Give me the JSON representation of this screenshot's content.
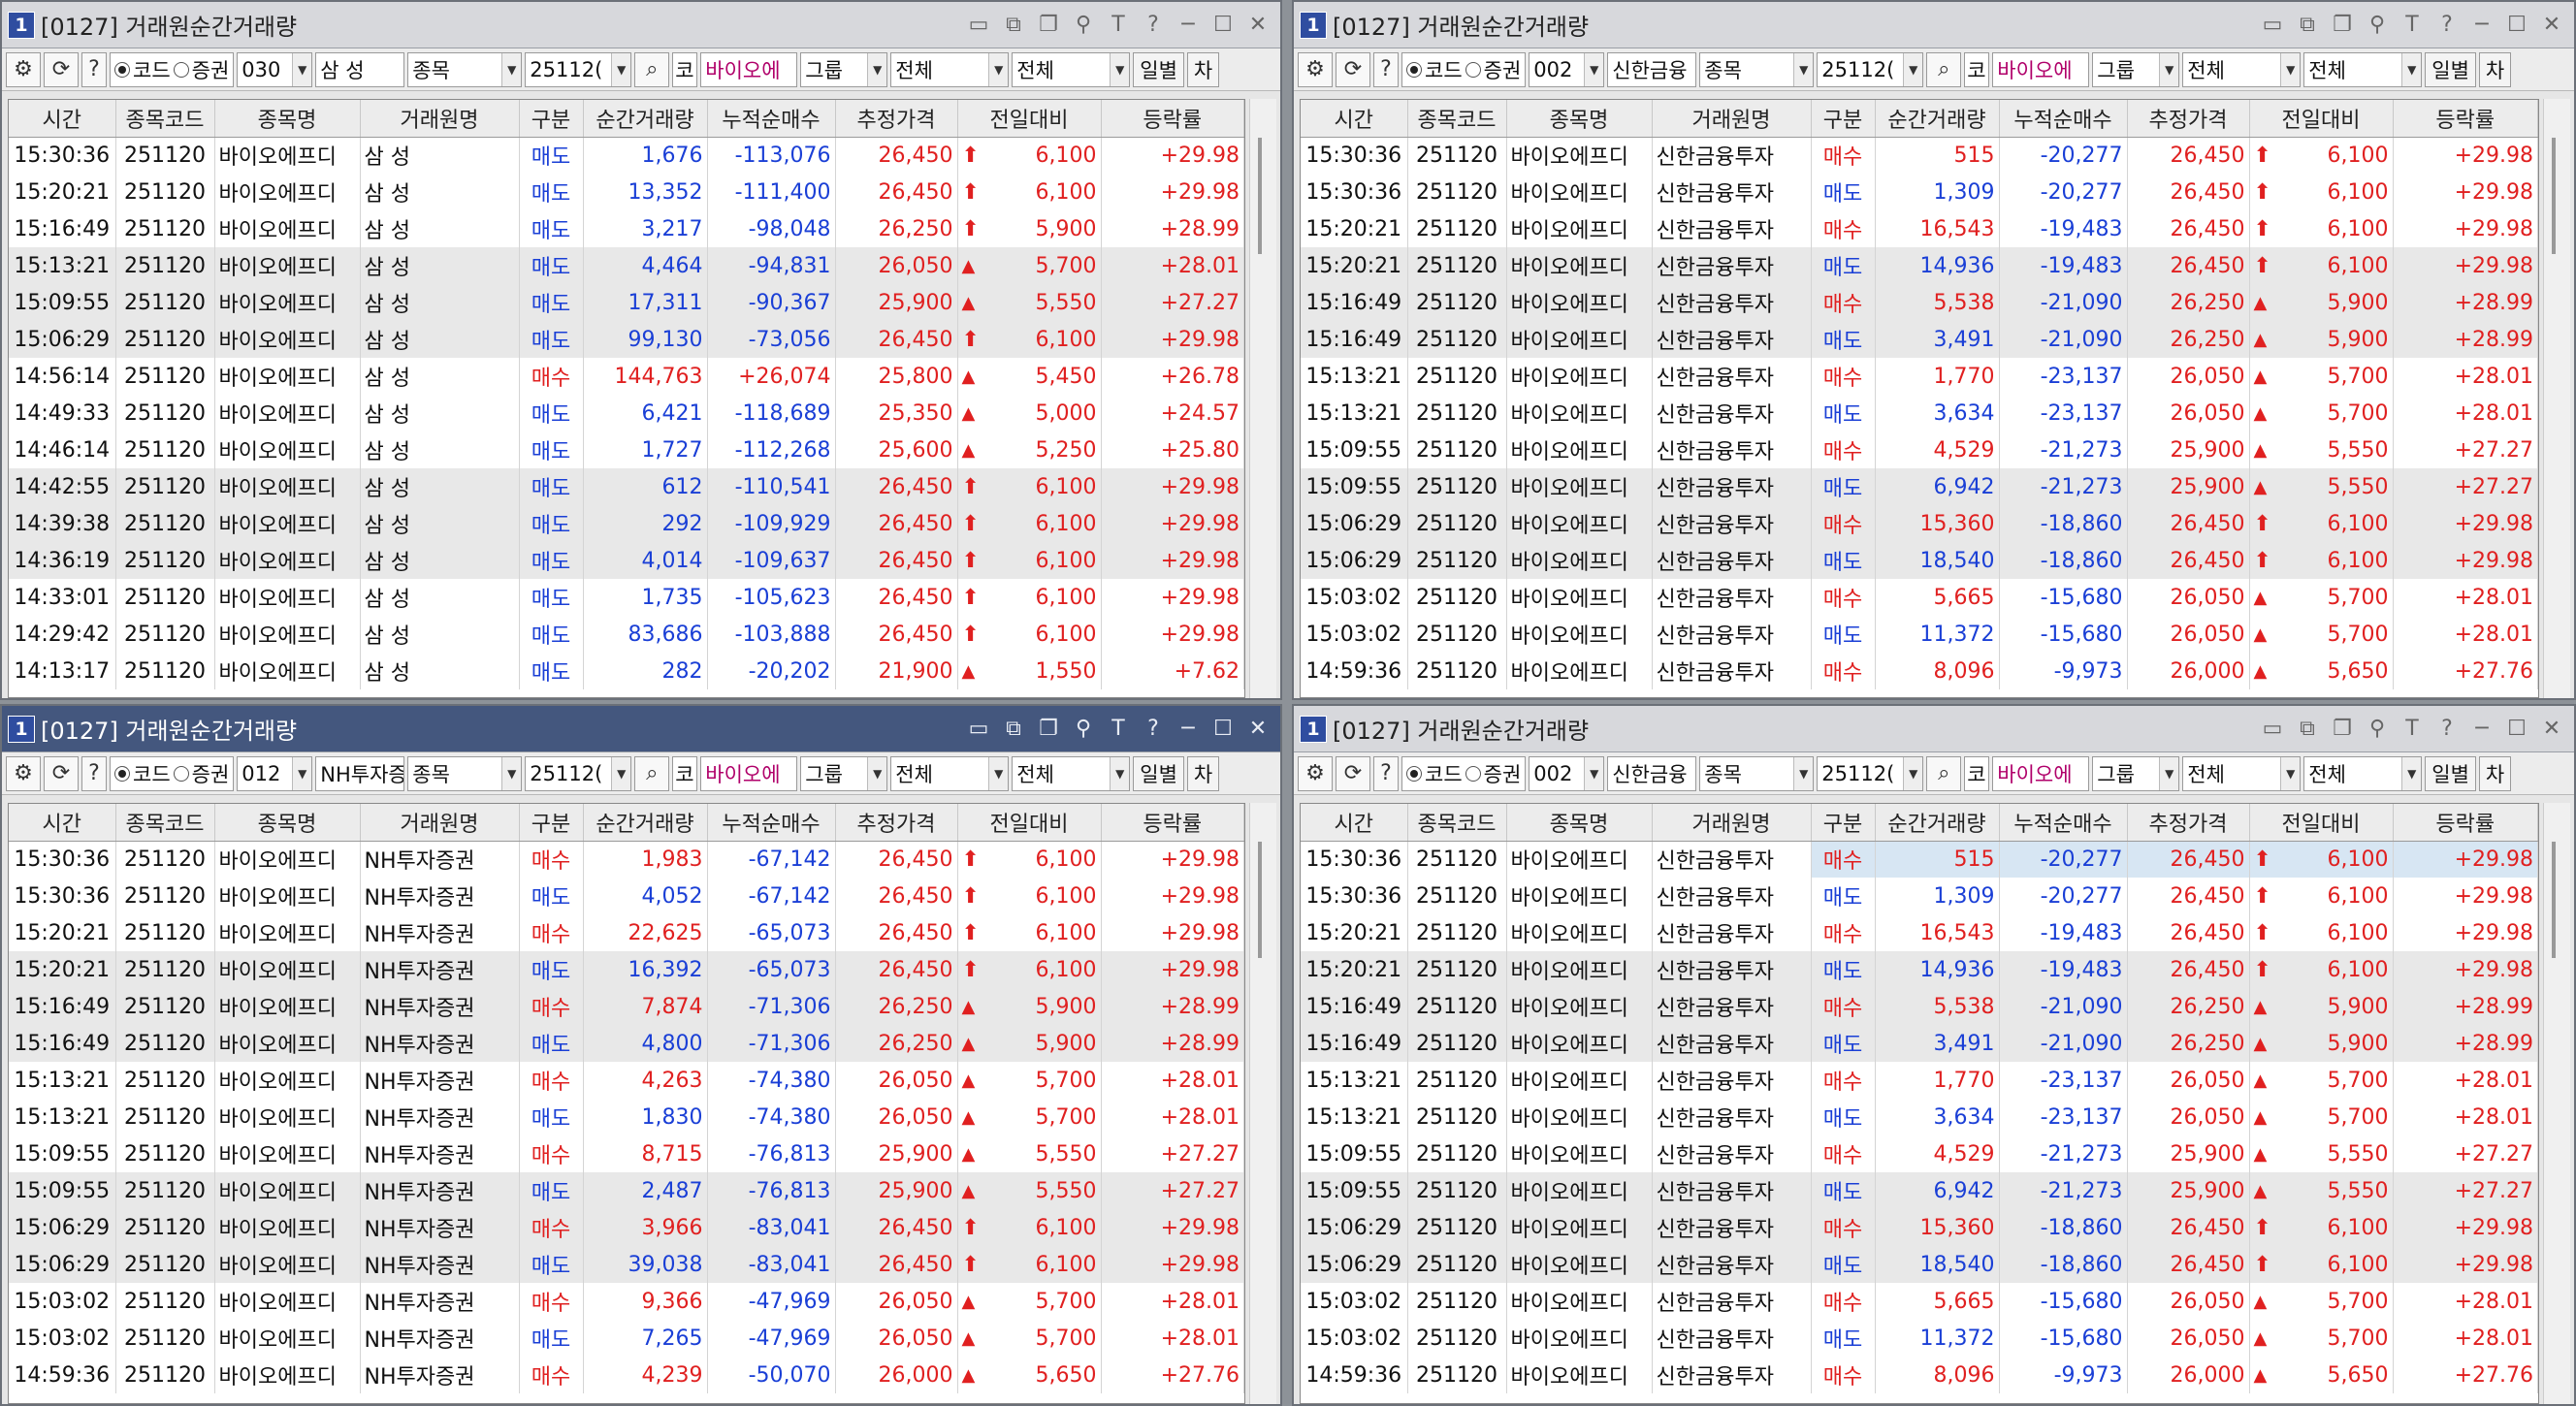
{
  "common": {
    "stock_code": "251120",
    "stock_name": "바이오에프디",
    "columns": [
      "시간",
      "종목코드",
      "종목명",
      "거래원명",
      "구분",
      "순간거래량",
      "누적순매수",
      "추정가격",
      "전일대비",
      "등락률"
    ]
  },
  "toolbar_labels": {
    "radio_code": "코드",
    "radio_broker": "증권",
    "type_combo": "종목",
    "code_field": "25112(",
    "ko_badge": "코",
    "stock_field": "바이오에",
    "group_button": "그룹",
    "filter1": "전체",
    "filter2": "전체",
    "daily_button": "일별",
    "chart_button": "차"
  },
  "windows": [
    {
      "title": "[0127] 거래원순간거래량",
      "num": "1",
      "active": false,
      "broker_code": "030",
      "broker_name": "삼   성",
      "rows": [
        [
          "15:30:36",
          "251120",
          "바이오에프디",
          "삼    성",
          "매도",
          "1,676",
          "-113,076",
          "26,450",
          "arrow",
          "6,100",
          "+29.98"
        ],
        [
          "15:20:21",
          "251120",
          "바이오에프디",
          "삼    성",
          "매도",
          "13,352",
          "-111,400",
          "26,450",
          "arrow",
          "6,100",
          "+29.98"
        ],
        [
          "15:16:49",
          "251120",
          "바이오에프디",
          "삼    성",
          "매도",
          "3,217",
          "-98,048",
          "26,250",
          "arrow",
          "5,900",
          "+28.99"
        ],
        [
          "15:13:21",
          "251120",
          "바이오에프디",
          "삼    성",
          "매도",
          "4,464",
          "-94,831",
          "26,050",
          "tri",
          "5,700",
          "+28.01"
        ],
        [
          "15:09:55",
          "251120",
          "바이오에프디",
          "삼    성",
          "매도",
          "17,311",
          "-90,367",
          "25,900",
          "tri",
          "5,550",
          "+27.27"
        ],
        [
          "15:06:29",
          "251120",
          "바이오에프디",
          "삼    성",
          "매도",
          "99,130",
          "-73,056",
          "26,450",
          "arrow",
          "6,100",
          "+29.98"
        ],
        [
          "14:56:14",
          "251120",
          "바이오에프디",
          "삼    성",
          "매수",
          "144,763",
          "+26,074",
          "25,800",
          "tri",
          "5,450",
          "+26.78"
        ],
        [
          "14:49:33",
          "251120",
          "바이오에프디",
          "삼    성",
          "매도",
          "6,421",
          "-118,689",
          "25,350",
          "tri",
          "5,000",
          "+24.57"
        ],
        [
          "14:46:14",
          "251120",
          "바이오에프디",
          "삼    성",
          "매도",
          "1,727",
          "-112,268",
          "25,600",
          "tri",
          "5,250",
          "+25.80"
        ],
        [
          "14:42:55",
          "251120",
          "바이오에프디",
          "삼    성",
          "매도",
          "612",
          "-110,541",
          "26,450",
          "arrow",
          "6,100",
          "+29.98"
        ],
        [
          "14:39:38",
          "251120",
          "바이오에프디",
          "삼    성",
          "매도",
          "292",
          "-109,929",
          "26,450",
          "arrow",
          "6,100",
          "+29.98"
        ],
        [
          "14:36:19",
          "251120",
          "바이오에프디",
          "삼    성",
          "매도",
          "4,014",
          "-109,637",
          "26,450",
          "arrow",
          "6,100",
          "+29.98"
        ],
        [
          "14:33:01",
          "251120",
          "바이오에프디",
          "삼    성",
          "매도",
          "1,735",
          "-105,623",
          "26,450",
          "arrow",
          "6,100",
          "+29.98"
        ],
        [
          "14:29:42",
          "251120",
          "바이오에프디",
          "삼    성",
          "매도",
          "83,686",
          "-103,888",
          "26,450",
          "arrow",
          "6,100",
          "+29.98"
        ],
        [
          "14:13:17",
          "251120",
          "바이오에프디",
          "삼    성",
          "매도",
          "282",
          "-20,202",
          "21,900",
          "tri",
          "1,550",
          "+7.62"
        ]
      ]
    },
    {
      "title": "[0127] 거래원순간거래량",
      "num": "1",
      "active": false,
      "broker_code": "002",
      "broker_name": "신한금융",
      "rows": [
        [
          "15:30:36",
          "251120",
          "바이오에프디",
          "신한금융투자",
          "매수",
          "515",
          "-20,277",
          "26,450",
          "arrow",
          "6,100",
          "+29.98"
        ],
        [
          "15:30:36",
          "251120",
          "바이오에프디",
          "신한금융투자",
          "매도",
          "1,309",
          "-20,277",
          "26,450",
          "arrow",
          "6,100",
          "+29.98"
        ],
        [
          "15:20:21",
          "251120",
          "바이오에프디",
          "신한금융투자",
          "매수",
          "16,543",
          "-19,483",
          "26,450",
          "arrow",
          "6,100",
          "+29.98"
        ],
        [
          "15:20:21",
          "251120",
          "바이오에프디",
          "신한금융투자",
          "매도",
          "14,936",
          "-19,483",
          "26,450",
          "arrow",
          "6,100",
          "+29.98"
        ],
        [
          "15:16:49",
          "251120",
          "바이오에프디",
          "신한금융투자",
          "매수",
          "5,538",
          "-21,090",
          "26,250",
          "tri",
          "5,900",
          "+28.99"
        ],
        [
          "15:16:49",
          "251120",
          "바이오에프디",
          "신한금융투자",
          "매도",
          "3,491",
          "-21,090",
          "26,250",
          "tri",
          "5,900",
          "+28.99"
        ],
        [
          "15:13:21",
          "251120",
          "바이오에프디",
          "신한금융투자",
          "매수",
          "1,770",
          "-23,137",
          "26,050",
          "tri",
          "5,700",
          "+28.01"
        ],
        [
          "15:13:21",
          "251120",
          "바이오에프디",
          "신한금융투자",
          "매도",
          "3,634",
          "-23,137",
          "26,050",
          "tri",
          "5,700",
          "+28.01"
        ],
        [
          "15:09:55",
          "251120",
          "바이오에프디",
          "신한금융투자",
          "매수",
          "4,529",
          "-21,273",
          "25,900",
          "tri",
          "5,550",
          "+27.27"
        ],
        [
          "15:09:55",
          "251120",
          "바이오에프디",
          "신한금융투자",
          "매도",
          "6,942",
          "-21,273",
          "25,900",
          "tri",
          "5,550",
          "+27.27"
        ],
        [
          "15:06:29",
          "251120",
          "바이오에프디",
          "신한금융투자",
          "매수",
          "15,360",
          "-18,860",
          "26,450",
          "arrow",
          "6,100",
          "+29.98"
        ],
        [
          "15:06:29",
          "251120",
          "바이오에프디",
          "신한금융투자",
          "매도",
          "18,540",
          "-18,860",
          "26,450",
          "arrow",
          "6,100",
          "+29.98"
        ],
        [
          "15:03:02",
          "251120",
          "바이오에프디",
          "신한금융투자",
          "매수",
          "5,665",
          "-15,680",
          "26,050",
          "tri",
          "5,700",
          "+28.01"
        ],
        [
          "15:03:02",
          "251120",
          "바이오에프디",
          "신한금융투자",
          "매도",
          "11,372",
          "-15,680",
          "26,050",
          "tri",
          "5,700",
          "+28.01"
        ],
        [
          "14:59:36",
          "251120",
          "바이오에프디",
          "신한금융투자",
          "매수",
          "8,096",
          "-9,973",
          "26,000",
          "tri",
          "5,650",
          "+27.76"
        ]
      ]
    },
    {
      "title": "[0127] 거래원순간거래량",
      "num": "1",
      "active": true,
      "broker_code": "012",
      "broker_name": "NH투자증",
      "rows": [
        [
          "15:30:36",
          "251120",
          "바이오에프디",
          "NH투자증권",
          "매수",
          "1,983",
          "-67,142",
          "26,450",
          "arrow",
          "6,100",
          "+29.98"
        ],
        [
          "15:30:36",
          "251120",
          "바이오에프디",
          "NH투자증권",
          "매도",
          "4,052",
          "-67,142",
          "26,450",
          "arrow",
          "6,100",
          "+29.98"
        ],
        [
          "15:20:21",
          "251120",
          "바이오에프디",
          "NH투자증권",
          "매수",
          "22,625",
          "-65,073",
          "26,450",
          "arrow",
          "6,100",
          "+29.98"
        ],
        [
          "15:20:21",
          "251120",
          "바이오에프디",
          "NH투자증권",
          "매도",
          "16,392",
          "-65,073",
          "26,450",
          "arrow",
          "6,100",
          "+29.98"
        ],
        [
          "15:16:49",
          "251120",
          "바이오에프디",
          "NH투자증권",
          "매수",
          "7,874",
          "-71,306",
          "26,250",
          "tri",
          "5,900",
          "+28.99"
        ],
        [
          "15:16:49",
          "251120",
          "바이오에프디",
          "NH투자증권",
          "매도",
          "4,800",
          "-71,306",
          "26,250",
          "tri",
          "5,900",
          "+28.99"
        ],
        [
          "15:13:21",
          "251120",
          "바이오에프디",
          "NH투자증권",
          "매수",
          "4,263",
          "-74,380",
          "26,050",
          "tri",
          "5,700",
          "+28.01"
        ],
        [
          "15:13:21",
          "251120",
          "바이오에프디",
          "NH투자증권",
          "매도",
          "1,830",
          "-74,380",
          "26,050",
          "tri",
          "5,700",
          "+28.01"
        ],
        [
          "15:09:55",
          "251120",
          "바이오에프디",
          "NH투자증권",
          "매수",
          "8,715",
          "-76,813",
          "25,900",
          "tri",
          "5,550",
          "+27.27"
        ],
        [
          "15:09:55",
          "251120",
          "바이오에프디",
          "NH투자증권",
          "매도",
          "2,487",
          "-76,813",
          "25,900",
          "tri",
          "5,550",
          "+27.27"
        ],
        [
          "15:06:29",
          "251120",
          "바이오에프디",
          "NH투자증권",
          "매수",
          "3,966",
          "-83,041",
          "26,450",
          "arrow",
          "6,100",
          "+29.98"
        ],
        [
          "15:06:29",
          "251120",
          "바이오에프디",
          "NH투자증권",
          "매도",
          "39,038",
          "-83,041",
          "26,450",
          "arrow",
          "6,100",
          "+29.98"
        ],
        [
          "15:03:02",
          "251120",
          "바이오에프디",
          "NH투자증권",
          "매수",
          "9,366",
          "-47,969",
          "26,050",
          "tri",
          "5,700",
          "+28.01"
        ],
        [
          "15:03:02",
          "251120",
          "바이오에프디",
          "NH투자증권",
          "매도",
          "7,265",
          "-47,969",
          "26,050",
          "tri",
          "5,700",
          "+28.01"
        ],
        [
          "14:59:36",
          "251120",
          "바이오에프디",
          "NH투자증권",
          "매수",
          "4,239",
          "-50,070",
          "26,000",
          "tri",
          "5,650",
          "+27.76"
        ]
      ]
    },
    {
      "title": "[0127] 거래원순간거래량",
      "num": "1",
      "active": false,
      "broker_code": "002",
      "broker_name": "신한금융",
      "rows": [
        [
          "15:30:36",
          "251120",
          "바이오에프디",
          "신한금융투자",
          "매수",
          "515",
          "-20,277",
          "26,450",
          "arrow",
          "6,100",
          "+29.98"
        ],
        [
          "15:30:36",
          "251120",
          "바이오에프디",
          "신한금융투자",
          "매도",
          "1,309",
          "-20,277",
          "26,450",
          "arrow",
          "6,100",
          "+29.98"
        ],
        [
          "15:20:21",
          "251120",
          "바이오에프디",
          "신한금융투자",
          "매수",
          "16,543",
          "-19,483",
          "26,450",
          "arrow",
          "6,100",
          "+29.98"
        ],
        [
          "15:20:21",
          "251120",
          "바이오에프디",
          "신한금융투자",
          "매도",
          "14,936",
          "-19,483",
          "26,450",
          "arrow",
          "6,100",
          "+29.98"
        ],
        [
          "15:16:49",
          "251120",
          "바이오에프디",
          "신한금융투자",
          "매수",
          "5,538",
          "-21,090",
          "26,250",
          "tri",
          "5,900",
          "+28.99"
        ],
        [
          "15:16:49",
          "251120",
          "바이오에프디",
          "신한금융투자",
          "매도",
          "3,491",
          "-21,090",
          "26,250",
          "tri",
          "5,900",
          "+28.99"
        ],
        [
          "15:13:21",
          "251120",
          "바이오에프디",
          "신한금융투자",
          "매수",
          "1,770",
          "-23,137",
          "26,050",
          "tri",
          "5,700",
          "+28.01"
        ],
        [
          "15:13:21",
          "251120",
          "바이오에프디",
          "신한금융투자",
          "매도",
          "3,634",
          "-23,137",
          "26,050",
          "tri",
          "5,700",
          "+28.01"
        ],
        [
          "15:09:55",
          "251120",
          "바이오에프디",
          "신한금융투자",
          "매수",
          "4,529",
          "-21,273",
          "25,900",
          "tri",
          "5,550",
          "+27.27"
        ],
        [
          "15:09:55",
          "251120",
          "바이오에프디",
          "신한금융투자",
          "매도",
          "6,942",
          "-21,273",
          "25,900",
          "tri",
          "5,550",
          "+27.27"
        ],
        [
          "15:06:29",
          "251120",
          "바이오에프디",
          "신한금융투자",
          "매수",
          "15,360",
          "-18,860",
          "26,450",
          "arrow",
          "6,100",
          "+29.98"
        ],
        [
          "15:06:29",
          "251120",
          "바이오에프디",
          "신한금융투자",
          "매도",
          "18,540",
          "-18,860",
          "26,450",
          "arrow",
          "6,100",
          "+29.98"
        ],
        [
          "15:03:02",
          "251120",
          "바이오에프디",
          "신한금융투자",
          "매수",
          "5,665",
          "-15,680",
          "26,050",
          "tri",
          "5,700",
          "+28.01"
        ],
        [
          "15:03:02",
          "251120",
          "바이오에프디",
          "신한금융투자",
          "매도",
          "11,372",
          "-15,680",
          "26,050",
          "tri",
          "5,700",
          "+28.01"
        ],
        [
          "14:59:36",
          "251120",
          "바이오에프디",
          "신한금융투자",
          "매수",
          "8,096",
          "-9,973",
          "26,000",
          "tri",
          "5,650",
          "+27.76"
        ]
      ]
    }
  ],
  "colors": {
    "sell": "#1a3fd6",
    "buy": "#e02020",
    "active_title": "#44577e"
  },
  "icons": [
    "window-number-icon",
    "monitor-icon",
    "restore-icon",
    "copy-icon",
    "pin-icon",
    "font-icon",
    "help-icon",
    "minimize-icon",
    "maximize-icon",
    "close-icon",
    "gear-icon",
    "refresh-icon",
    "search-icon",
    "chevron-down-icon",
    "arrow-up-icon",
    "triangle-up-icon"
  ]
}
